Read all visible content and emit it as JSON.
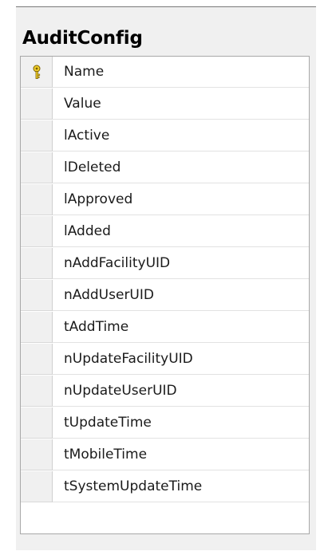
{
  "table": {
    "title": "AuditConfig",
    "columns": [
      {
        "name": "Name",
        "primary_key": true,
        "icon": "primary-key-icon"
      },
      {
        "name": "Value",
        "primary_key": false
      },
      {
        "name": "lActive",
        "primary_key": false
      },
      {
        "name": "lDeleted",
        "primary_key": false
      },
      {
        "name": "lApproved",
        "primary_key": false
      },
      {
        "name": "lAdded",
        "primary_key": false
      },
      {
        "name": "nAddFacilityUID",
        "primary_key": false
      },
      {
        "name": "nAddUserUID",
        "primary_key": false
      },
      {
        "name": "tAddTime",
        "primary_key": false
      },
      {
        "name": "nUpdateFacilityUID",
        "primary_key": false
      },
      {
        "name": "nUpdateUserUID",
        "primary_key": false
      },
      {
        "name": "tUpdateTime",
        "primary_key": false
      },
      {
        "name": "tMobileTime",
        "primary_key": false
      },
      {
        "name": "tSystemUpdateTime",
        "primary_key": false
      }
    ]
  },
  "colors": {
    "panel_background": "#f0f0f0",
    "grid_background": "#ffffff",
    "key_icon": "#d4b000"
  }
}
